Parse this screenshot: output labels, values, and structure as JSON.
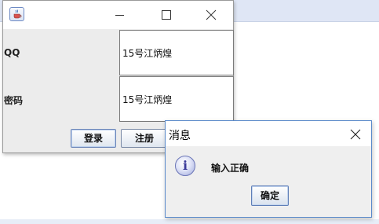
{
  "main_window": {
    "title": "",
    "icon": "java-cup-icon",
    "controls": [
      "minimize-icon",
      "maximize-icon",
      "close-icon"
    ],
    "qq_label": "QQ",
    "password_label": "密码",
    "qq_value": "15号江炳煌",
    "password_value": "15号江炳煌",
    "login_label": "登录",
    "register_label": "注册"
  },
  "dialog": {
    "title": "消息",
    "icon": "info-icon",
    "icon_glyph": "i",
    "message": "输入正确",
    "ok_label": "确定"
  }
}
